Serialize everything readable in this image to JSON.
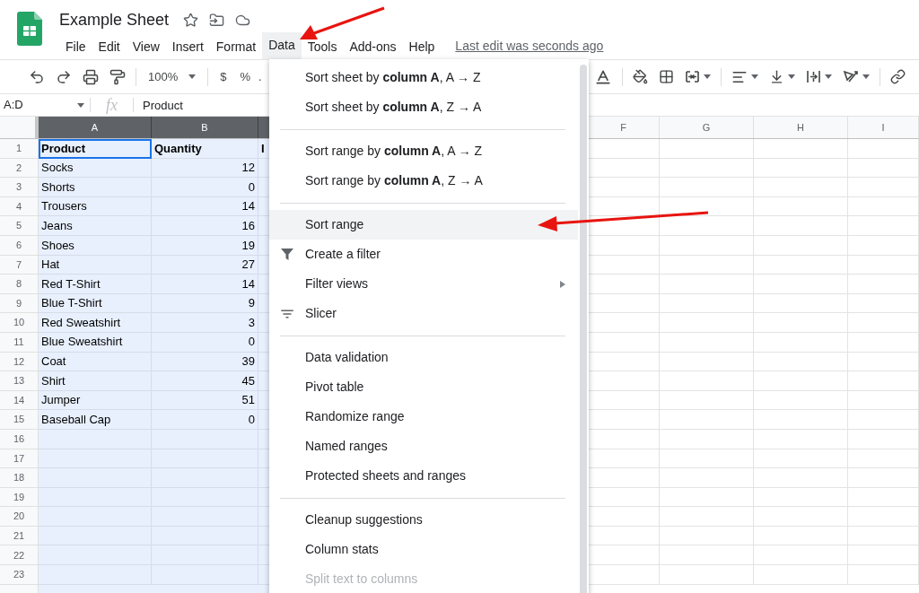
{
  "document": {
    "title": "Example Sheet"
  },
  "menu_bar": {
    "items": [
      {
        "label": "File",
        "selected": false
      },
      {
        "label": "Edit",
        "selected": false
      },
      {
        "label": "View",
        "selected": false
      },
      {
        "label": "Insert",
        "selected": false
      },
      {
        "label": "Format",
        "selected": false
      },
      {
        "label": "Data",
        "selected": true
      },
      {
        "label": "Tools",
        "selected": false
      },
      {
        "label": "Add-ons",
        "selected": false
      },
      {
        "label": "Help",
        "selected": false
      }
    ],
    "last_edit": "Last edit was seconds ago"
  },
  "toolbar": {
    "zoom": "100%",
    "currency": "$",
    "percent": "%",
    "decimal": "."
  },
  "formula_bar": {
    "name_box": "A:D",
    "fx": "fx",
    "value": "Product"
  },
  "grid": {
    "columns": [
      {
        "label": "A",
        "selected": true
      },
      {
        "label": "B",
        "selected": true
      },
      {
        "label": "F",
        "selected": false
      },
      {
        "label": "G",
        "selected": false
      },
      {
        "label": "H",
        "selected": false
      },
      {
        "label": "I",
        "selected": false
      }
    ],
    "rows": [
      {
        "number": "1",
        "bold": true,
        "a": "Product",
        "b": "Quantity",
        "c": "I"
      },
      {
        "number": "2",
        "bold": false,
        "a": "Socks",
        "b": "12"
      },
      {
        "number": "3",
        "bold": false,
        "a": "Shorts",
        "b": "0"
      },
      {
        "number": "4",
        "bold": false,
        "a": "Trousers",
        "b": "14"
      },
      {
        "number": "5",
        "bold": false,
        "a": "Jeans",
        "b": "16"
      },
      {
        "number": "6",
        "bold": false,
        "a": "Shoes",
        "b": "19"
      },
      {
        "number": "7",
        "bold": false,
        "a": "Hat",
        "b": "27"
      },
      {
        "number": "8",
        "bold": false,
        "a": "Red T-Shirt",
        "b": "14"
      },
      {
        "number": "9",
        "bold": false,
        "a": "Blue T-Shirt",
        "b": "9"
      },
      {
        "number": "10",
        "bold": false,
        "a": "Red Sweatshirt",
        "b": "3"
      },
      {
        "number": "11",
        "bold": false,
        "a": "Blue Sweatshirt",
        "b": "0"
      },
      {
        "number": "12",
        "bold": false,
        "a": "Coat",
        "b": "39"
      },
      {
        "number": "13",
        "bold": false,
        "a": "Shirt",
        "b": "45"
      },
      {
        "number": "14",
        "bold": false,
        "a": "Jumper",
        "b": "51"
      },
      {
        "number": "15",
        "bold": false,
        "a": "Baseball Cap",
        "b": "0"
      },
      {
        "number": "16",
        "bold": false
      },
      {
        "number": "17",
        "bold": false
      },
      {
        "number": "18",
        "bold": false
      },
      {
        "number": "19",
        "bold": false
      },
      {
        "number": "20",
        "bold": false
      },
      {
        "number": "21",
        "bold": false
      },
      {
        "number": "22",
        "bold": false
      },
      {
        "number": "23",
        "bold": false
      }
    ]
  },
  "data_menu": {
    "items": [
      {
        "kind": "item",
        "label": "Sort sheet by **column A**, A → Z",
        "highlighted": false,
        "disabled": false
      },
      {
        "kind": "item",
        "label": "Sort sheet by **column A**, Z → A",
        "highlighted": false,
        "disabled": false
      },
      {
        "kind": "separator"
      },
      {
        "kind": "item",
        "label": "Sort range by **column A**, A → Z",
        "highlighted": false,
        "disabled": false
      },
      {
        "kind": "item",
        "label": "Sort range by **column A**, Z → A",
        "highlighted": false,
        "disabled": false
      },
      {
        "kind": "separator"
      },
      {
        "kind": "item",
        "label": "Sort range",
        "highlighted": true,
        "disabled": false
      },
      {
        "kind": "filter",
        "label": "Create a filter",
        "highlighted": false,
        "disabled": false
      },
      {
        "kind": "submenu",
        "label": "Filter views",
        "highlighted": false,
        "disabled": false
      },
      {
        "kind": "slicer",
        "label": "Slicer",
        "highlighted": false,
        "disabled": false
      },
      {
        "kind": "separator"
      },
      {
        "kind": "item",
        "label": "Data validation",
        "highlighted": false,
        "disabled": false
      },
      {
        "kind": "item",
        "label": "Pivot table",
        "highlighted": false,
        "disabled": false
      },
      {
        "kind": "item",
        "label": "Randomize range",
        "highlighted": false,
        "disabled": false
      },
      {
        "kind": "item",
        "label": "Named ranges",
        "highlighted": false,
        "disabled": false
      },
      {
        "kind": "item",
        "label": "Protected sheets and ranges",
        "highlighted": false,
        "disabled": false
      },
      {
        "kind": "separator"
      },
      {
        "kind": "item",
        "label": "Cleanup suggestions",
        "highlighted": false,
        "disabled": false
      },
      {
        "kind": "item",
        "label": "Column stats",
        "highlighted": false,
        "disabled": false
      },
      {
        "kind": "item",
        "label": "Split text to columns",
        "highlighted": false,
        "disabled": true
      }
    ]
  }
}
